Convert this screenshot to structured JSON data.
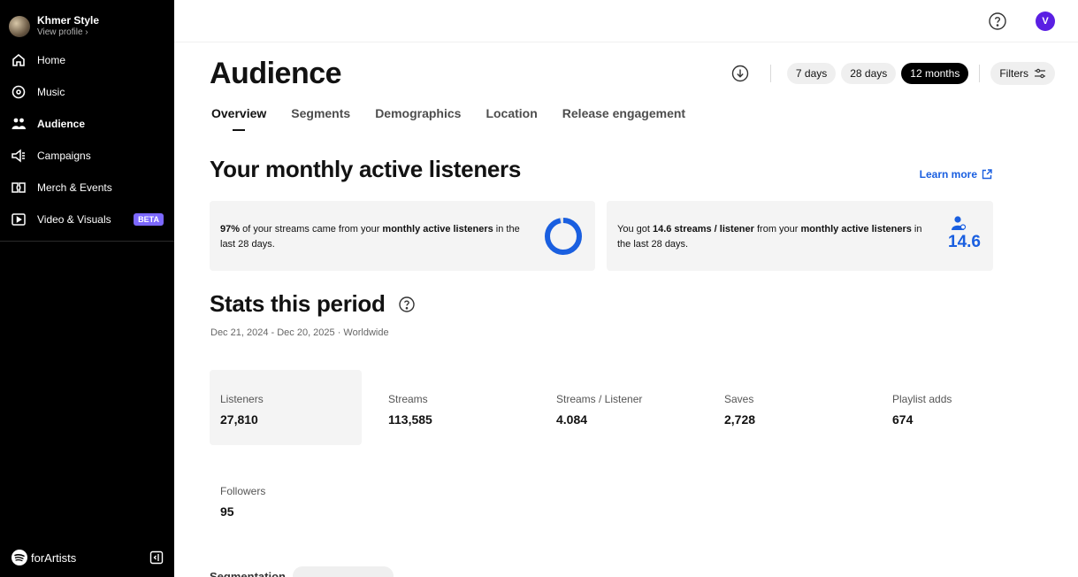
{
  "profile": {
    "name": "Khmer Style",
    "link": "View profile ›"
  },
  "nav": {
    "items": [
      {
        "label": "Home",
        "icon": "home-icon"
      },
      {
        "label": "Music",
        "icon": "music-icon"
      },
      {
        "label": "Audience",
        "icon": "audience-icon",
        "active": true
      },
      {
        "label": "Campaigns",
        "icon": "megaphone-icon"
      },
      {
        "label": "Merch & Events",
        "icon": "ticket-icon"
      },
      {
        "label": "Video & Visuals",
        "icon": "video-icon",
        "badge": "BETA"
      }
    ]
  },
  "footer": {
    "brand": "forArtists"
  },
  "topbar": {
    "user_initial": "V"
  },
  "page": {
    "title": "Audience"
  },
  "controls": {
    "ranges": [
      "7 days",
      "28 days",
      "12 months"
    ],
    "active_range": "12 months",
    "filters_label": "Filters"
  },
  "tabs": [
    {
      "label": "Overview",
      "active": true
    },
    {
      "label": "Segments"
    },
    {
      "label": "Demographics"
    },
    {
      "label": "Location"
    },
    {
      "label": "Release engagement"
    }
  ],
  "monthly": {
    "title": "Your monthly active listeners",
    "learn_more": "Learn more",
    "card1": {
      "pct": "97%",
      "t1": " of your streams came from your ",
      "bold": "monthly active listeners",
      "t2": " in the last 28 days.",
      "donut_fraction": 0.97
    },
    "card2": {
      "t1": "You got ",
      "bold1": "14.6 streams / listener",
      "t2": " from your ",
      "bold2": "monthly active listeners",
      "t3": " in the last 28 days.",
      "value": "14.6"
    }
  },
  "stats": {
    "title": "Stats this period",
    "date_range": "Dec 21, 2024 - Dec 20, 2025 · Worldwide",
    "items": [
      {
        "label": "Listeners",
        "value": "27,810"
      },
      {
        "label": "Streams",
        "value": "113,585"
      },
      {
        "label": "Streams / Listener",
        "value": "4.084"
      },
      {
        "label": "Saves",
        "value": "2,728"
      },
      {
        "label": "Playlist adds",
        "value": "674"
      },
      {
        "label": "Followers",
        "value": "95"
      }
    ]
  },
  "cutoff": {
    "text": "Segmentation"
  },
  "colors": {
    "accent": "#1a5fe0",
    "beta": "#7c68ff",
    "avatar": "#5a1fe3"
  }
}
